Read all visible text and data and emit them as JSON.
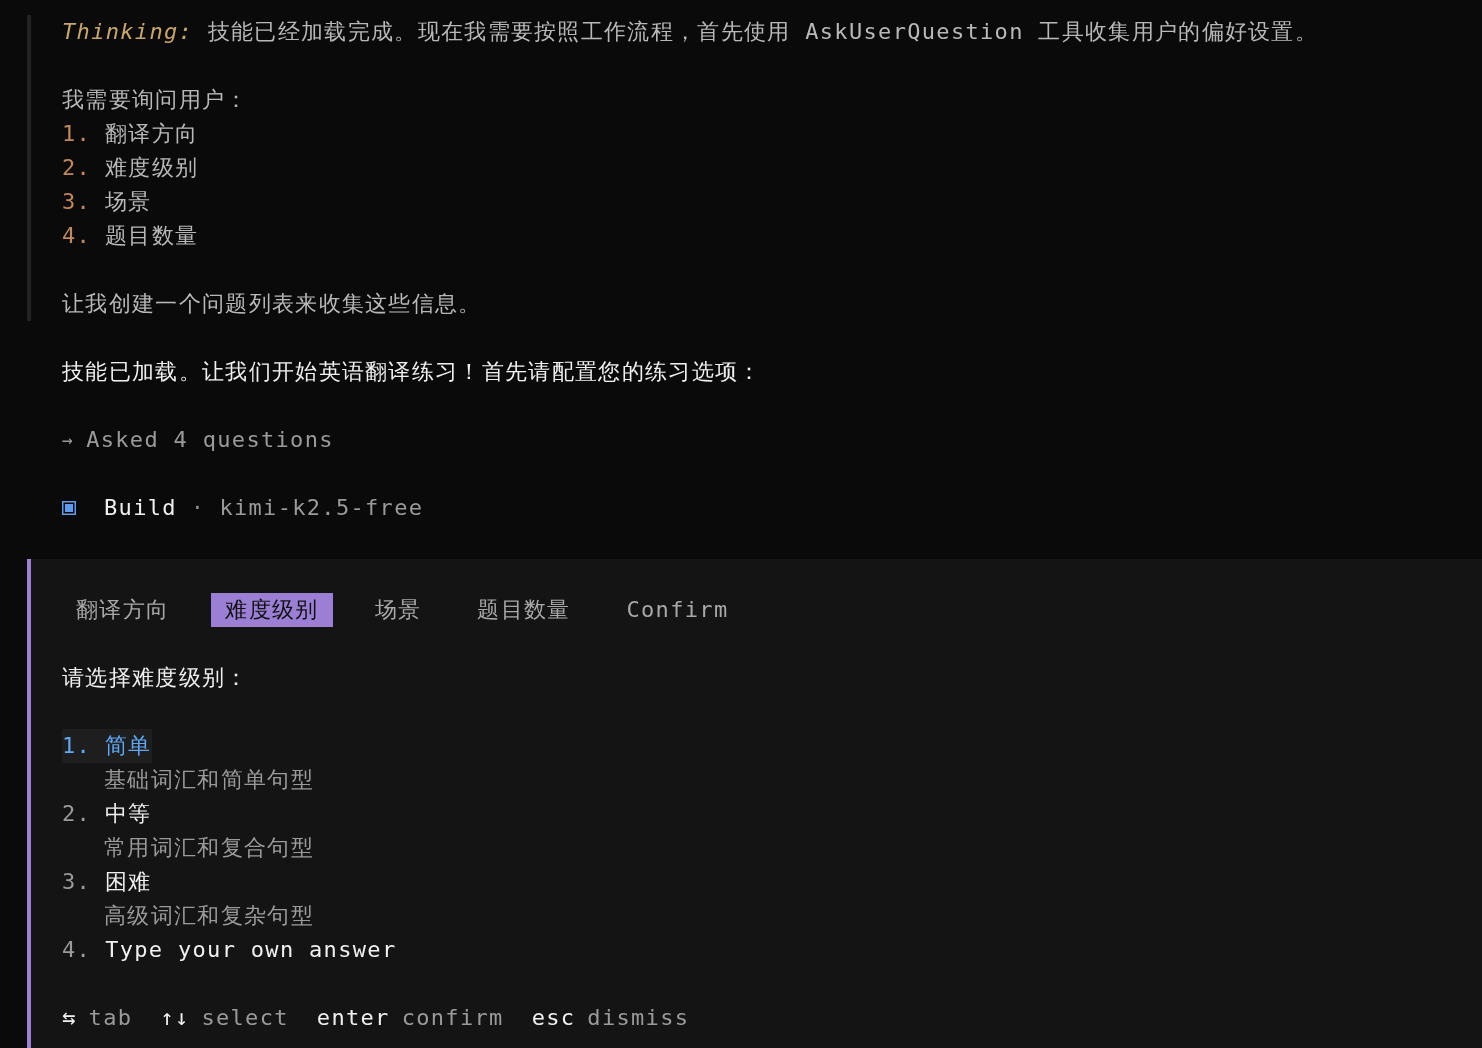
{
  "thinking": {
    "label": "Thinking:",
    "text": "技能已经加载完成。现在我需要按照工作流程，首先使用 AskUserQuestion 工具收集用户的偏好设置。",
    "heading": "我需要询问用户：",
    "items": [
      {
        "number": "1.",
        "text": "翻译方向"
      },
      {
        "number": "2.",
        "text": "难度级别"
      },
      {
        "number": "3.",
        "text": "场景"
      },
      {
        "number": "4.",
        "text": "题目数量"
      }
    ],
    "closing": "让我创建一个问题列表来收集这些信息。"
  },
  "message": "技能已加载。让我们开始英语翻译练习！首先请配置您的练习选项：",
  "tool_call": {
    "arrow": "→",
    "text": "Asked 4 questions"
  },
  "agent": {
    "mode": "Build",
    "separator": "·",
    "model": "kimi-k2.5-free"
  },
  "question_panel": {
    "tabs": [
      {
        "label": "翻译方向",
        "selected": false
      },
      {
        "label": "难度级别",
        "selected": true
      },
      {
        "label": "场景",
        "selected": false
      },
      {
        "label": "题目数量",
        "selected": false
      },
      {
        "label": "Confirm",
        "selected": false
      }
    ],
    "prompt": "请选择难度级别：",
    "options": [
      {
        "number": "1.",
        "label": "简单",
        "description": "基础词汇和简单句型",
        "selected": true
      },
      {
        "number": "2.",
        "label": "中等",
        "description": "常用词汇和复合句型",
        "selected": false
      },
      {
        "number": "3.",
        "label": "困难",
        "description": "高级词汇和复杂句型",
        "selected": false
      },
      {
        "number": "4.",
        "label": "Type your own answer",
        "selected": false
      }
    ],
    "hints": [
      {
        "key": "⇆",
        "action": "tab"
      },
      {
        "key": "↑↓",
        "action": "select"
      },
      {
        "key": "enter",
        "action": "confirm"
      },
      {
        "key": "esc",
        "action": "dismiss"
      }
    ]
  }
}
